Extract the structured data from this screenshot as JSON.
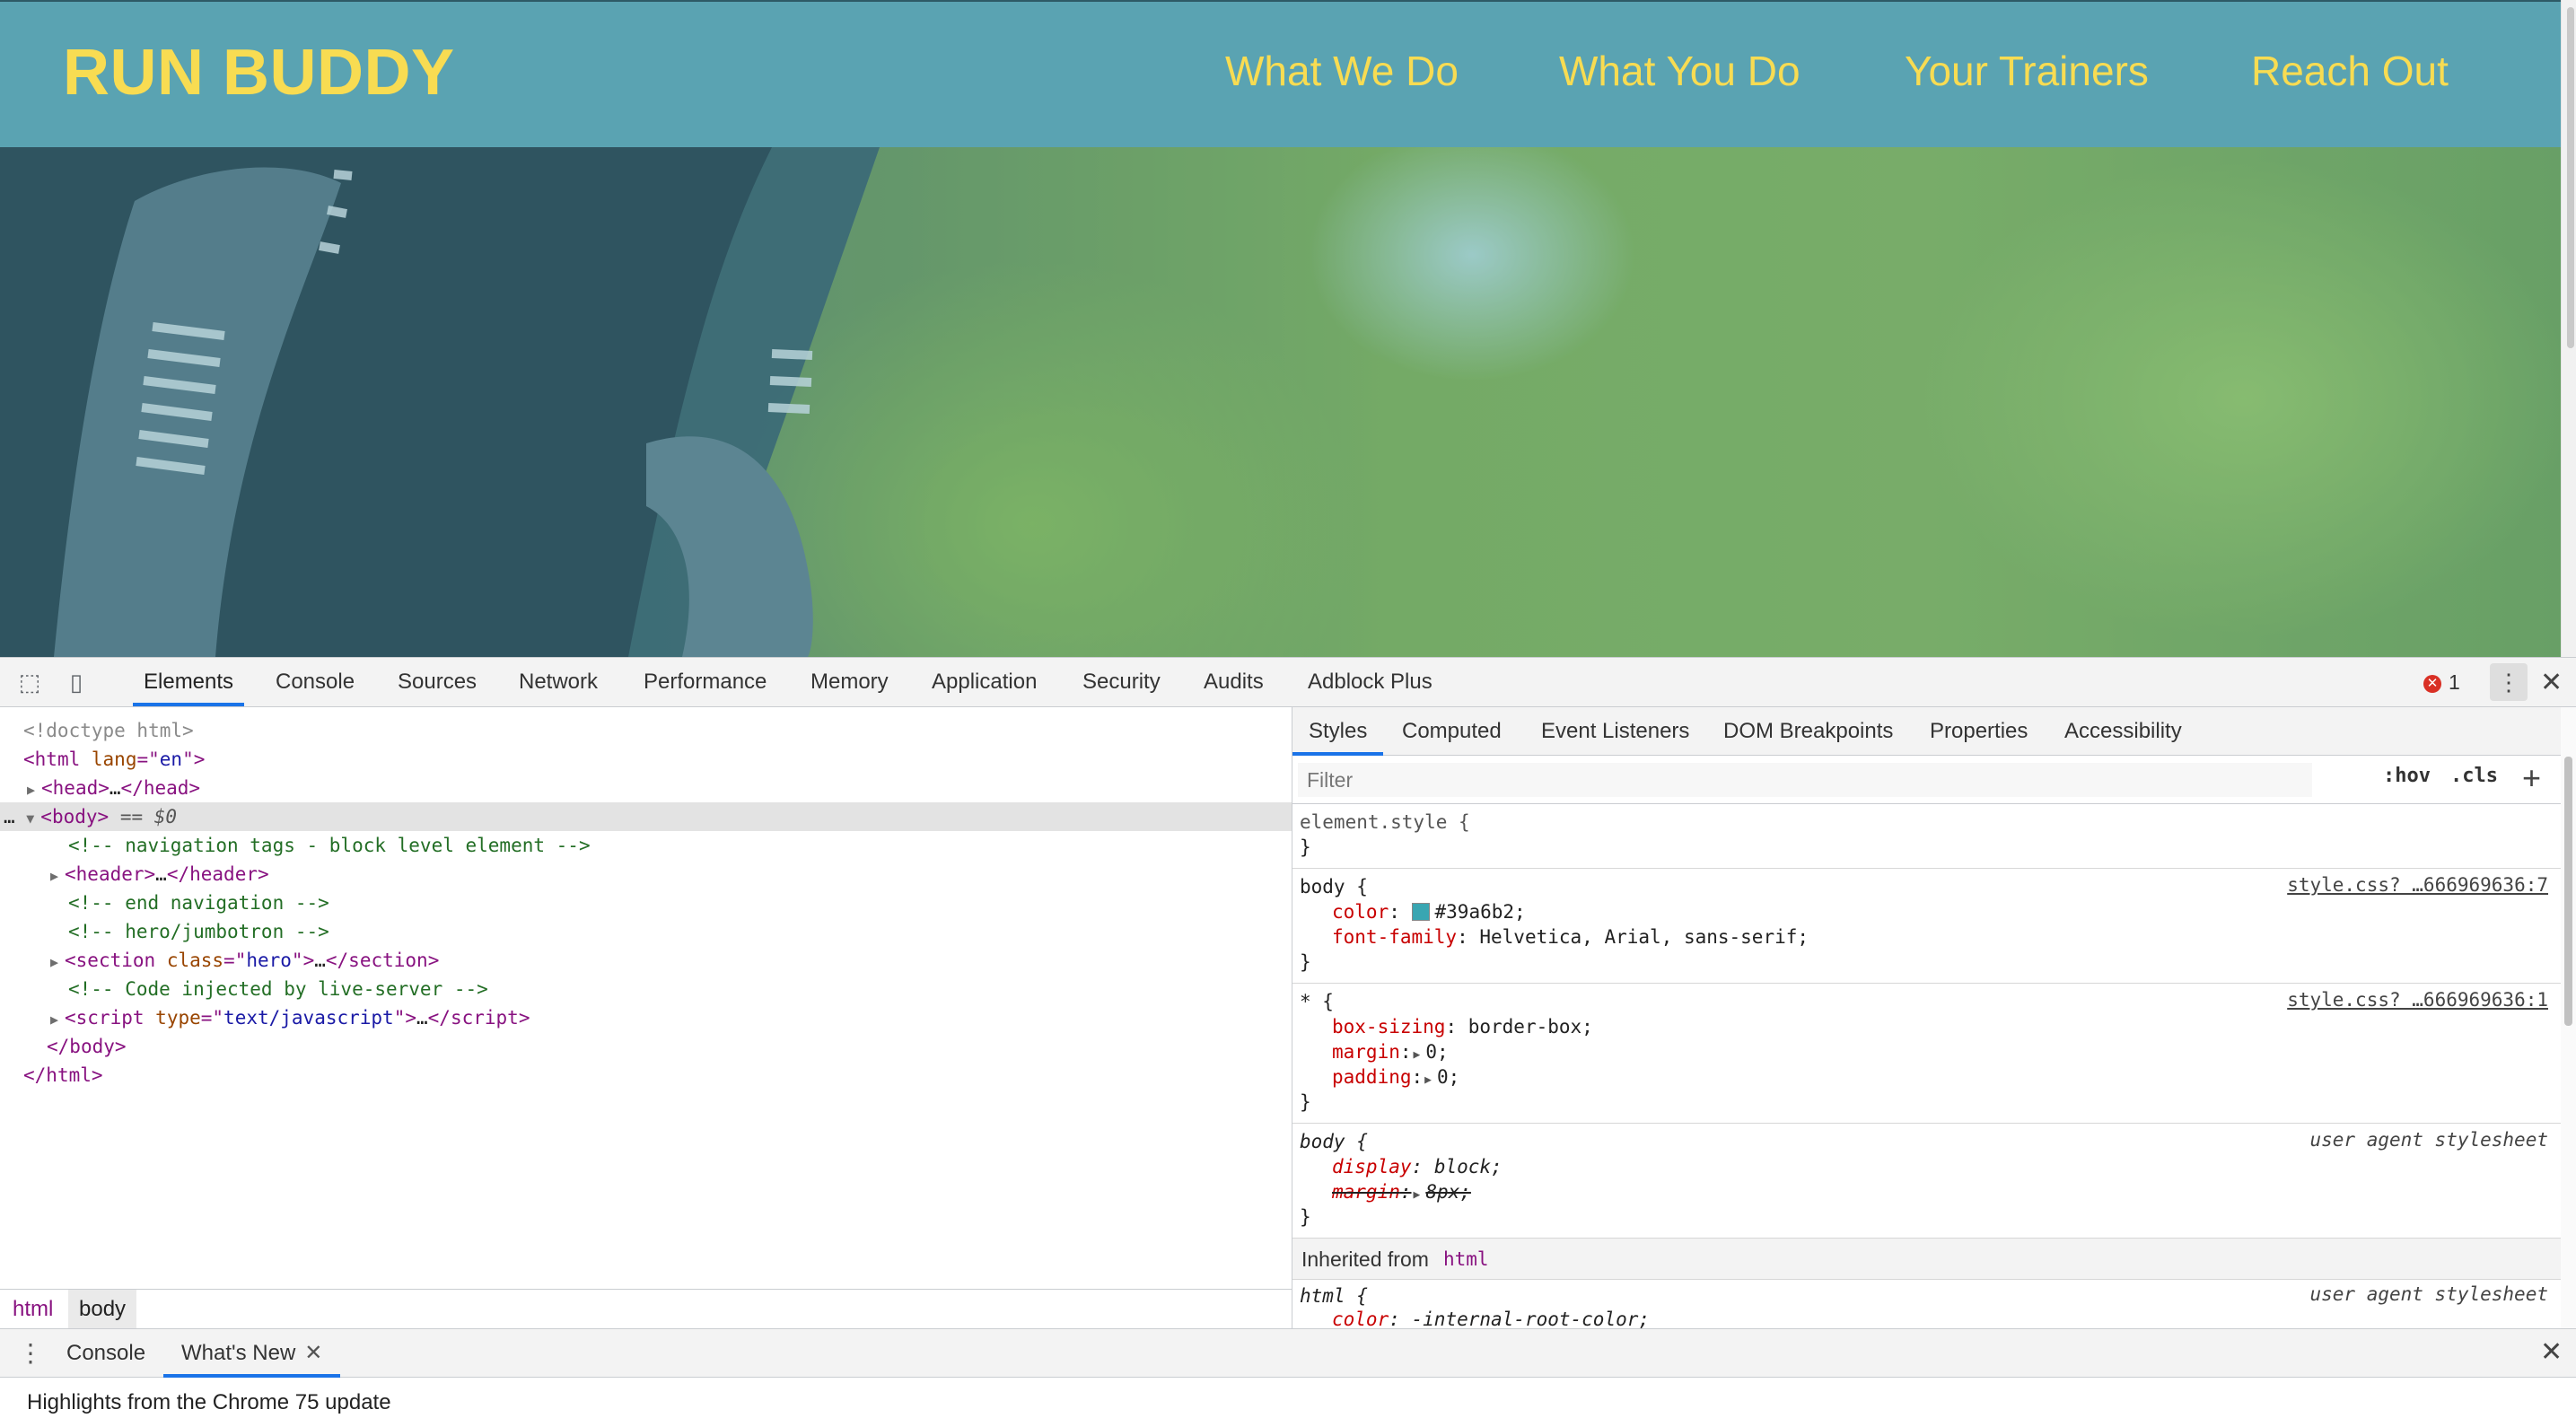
{
  "site": {
    "brand": "RUN BUDDY",
    "nav": [
      "What We Do",
      "What You Do",
      "Your Trainers",
      "Reach Out"
    ]
  },
  "devtools": {
    "tabs": [
      "Elements",
      "Console",
      "Sources",
      "Network",
      "Performance",
      "Memory",
      "Application",
      "Security",
      "Audits",
      "Adblock Plus"
    ],
    "active_tab": "Elements",
    "error_count": "1",
    "dom": {
      "doctype": "<!doctype html>",
      "html_open_tag": "html",
      "lang_attr": "lang",
      "lang_val": "en",
      "head_tag": "head",
      "body_tag": "body",
      "selected_suffix": "== $0",
      "comment_nav": "<!-- navigation tags - block level element -->",
      "header_tag": "header",
      "comment_end_nav": "<!-- end navigation -->",
      "comment_hero": "<!-- hero/jumbotron -->",
      "section_tag": "section",
      "class_attr": "class",
      "class_val": "hero",
      "comment_live": "<!-- Code injected by live-server -->",
      "script_tag": "script",
      "type_attr": "type",
      "type_val": "text/javascript",
      "ellipsis": "…"
    },
    "breadcrumbs": [
      "html",
      "body"
    ],
    "styles": {
      "tabs": [
        "Styles",
        "Computed",
        "Event Listeners",
        "DOM Breakpoints",
        "Properties",
        "Accessibility"
      ],
      "filter_placeholder": "Filter",
      "hov": ":hov",
      "cls": ".cls",
      "element_style": "element.style {",
      "close_brace": "}",
      "body_selector": "body {",
      "star_selector": "* {",
      "css_source_1": "style.css? …666969636:7",
      "css_source_2": "style.css? …666969636:1",
      "ua_label": "user agent stylesheet",
      "color_prop": "color",
      "color_val": "#39a6b2;",
      "font_prop": "font-family",
      "font_val": "Helvetica, Arial, sans-serif;",
      "box_prop": "box-sizing",
      "box_val": "border-box;",
      "margin_prop": "margin",
      "margin_val": "0;",
      "padding_prop": "padding",
      "padding_val": "0;",
      "display_prop": "display",
      "display_val": "block;",
      "ua_margin_val": "8px;",
      "inherited_label": "Inherited from",
      "inherited_tag": "html",
      "html_selector": "html {",
      "html_color_prop": "color",
      "html_color_val": "-internal-root-color;"
    },
    "drawer": {
      "tabs": [
        "Console",
        "What's New"
      ],
      "active": "What's New",
      "message": "Highlights from the Chrome 75 update"
    }
  },
  "colors": {
    "brand_yellow": "#f8dc52",
    "header_teal": "#5aa3b2",
    "body_color": "#39a6b2",
    "devtools_accent": "#1a73e8"
  }
}
